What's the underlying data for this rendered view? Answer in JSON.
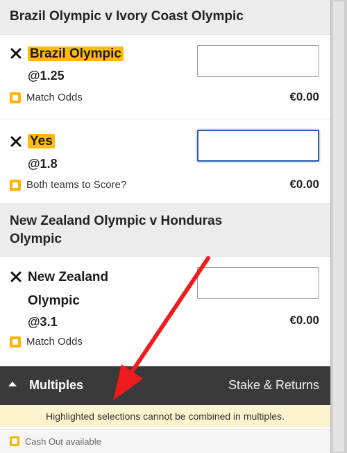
{
  "events": [
    {
      "title": "Brazil Olympic v Ivory Coast Olympic",
      "selection": "Brazil Olympic",
      "odds": "@1.25",
      "market": "Match Odds",
      "returns": "€0.00"
    },
    {
      "selection": "Yes",
      "odds": "@1.8",
      "market": "Both teams to Score?",
      "returns": "€0.00"
    },
    {
      "title_line1": "New Zealand Olympic v Honduras",
      "title_line2": "Olympic",
      "selection_line1": "New Zealand",
      "selection_line2": "Olympic",
      "odds": "@3.1",
      "market": "Match Odds",
      "returns": "€0.00"
    }
  ],
  "multiples": {
    "title": "Multiples",
    "right_label": "Stake & Returns",
    "warning": "Highlighted selections cannot be combined in multiples."
  },
  "cash_out": {
    "label": "Cash Out available"
  },
  "colors": {
    "highlight": "#ffbb00",
    "header_bg": "#ececec",
    "bar_bg": "#3a3a3a",
    "warning_bg": "#fdf3cf",
    "arrow": "#ee1c1c"
  },
  "icons": [
    "remove-x-icon",
    "market-square-icon",
    "caret-up-icon",
    "red-annotation-arrow"
  ]
}
